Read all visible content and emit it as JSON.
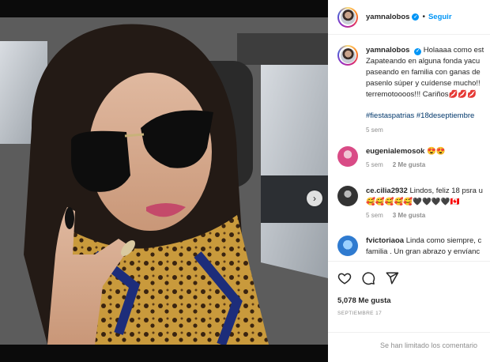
{
  "header": {
    "username": "yamnalobos",
    "separator": "•",
    "follow_label": "Seguir"
  },
  "caption": {
    "username": "yamnalobos",
    "lines": [
      "Holaaaa como est",
      "Zapateando en alguna fonda yacu",
      "paseando en familia con ganas de",
      "pasenlo súper y cuídense mucho!!",
      "terremotoooos!!! Cariños💋💋💋"
    ],
    "hashtags": "#fiestaspatrias #18deseptiembre",
    "time": "5 sem"
  },
  "comments": [
    {
      "username": "eugenialemosok",
      "text": "😍😍",
      "time": "5 sem",
      "likes": "2 Me gusta",
      "extra": ""
    },
    {
      "username": "ce.cilia2932",
      "text": "Lindos, feliz 18 psra u",
      "text2": "🥰🥰🥰🥰🥰🖤🖤🖤🖤🇨🇦",
      "time": "5 sem",
      "likes": "3 Me gusta"
    },
    {
      "username": "fvictoriaoa",
      "text": "Linda como siempre, c",
      "text2": "familia . Un gran abrazo y envíanc"
    }
  ],
  "actions": {
    "likes": "5,078 Me gusta",
    "date": "SEPTIEMBRE 17"
  },
  "footer": {
    "limited": "Se han limitado los comentario"
  },
  "carousel": {
    "next_icon": "chevron-right-icon"
  },
  "colors": {
    "accent": "#0095f6",
    "verified": "#0095f6",
    "hashtag": "#00376b",
    "muted": "#8e8e8e"
  }
}
